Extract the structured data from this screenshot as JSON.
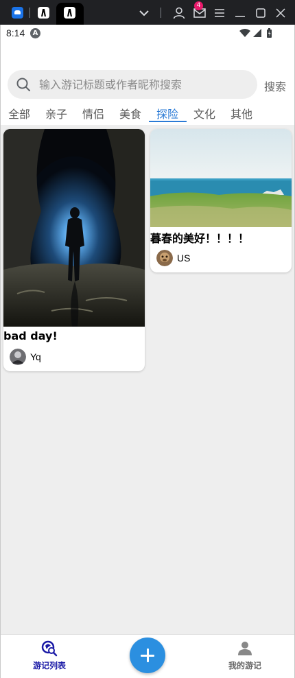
{
  "window": {
    "badge_count": "4",
    "icons": [
      "app-icon",
      "app-icon",
      "app-icon-active",
      "chevron-down-icon",
      "user-icon",
      "mail-icon",
      "menu-icon",
      "minimize-icon",
      "maximize-icon",
      "close-icon"
    ]
  },
  "status_bar": {
    "time": "8:14",
    "notification_glyph": "A",
    "icons": [
      "wifi-icon",
      "signal-icon",
      "battery-icon"
    ]
  },
  "search": {
    "placeholder": "输入游记标题或作者昵称搜索",
    "button_label": "搜索"
  },
  "tabs": [
    {
      "label": "全部"
    },
    {
      "label": "亲子"
    },
    {
      "label": "情侣"
    },
    {
      "label": "美食"
    },
    {
      "label": "探险",
      "active": true
    },
    {
      "label": "文化"
    },
    {
      "label": "其他"
    }
  ],
  "active_tab_color": "#2b7bd6",
  "posts": [
    {
      "title": "bad day!",
      "author": "Yq",
      "image": "cave-explorer-photo"
    },
    {
      "title": "暮春的美好！！！！",
      "author": "US",
      "image": "seaside-meadow-photo"
    }
  ],
  "bottom_nav": {
    "list_label": "游记列表",
    "mine_label": "我的游记",
    "fab_icon": "plus-icon",
    "active_color": "#1a1aa6",
    "fab_color": "#2b8fe0"
  }
}
